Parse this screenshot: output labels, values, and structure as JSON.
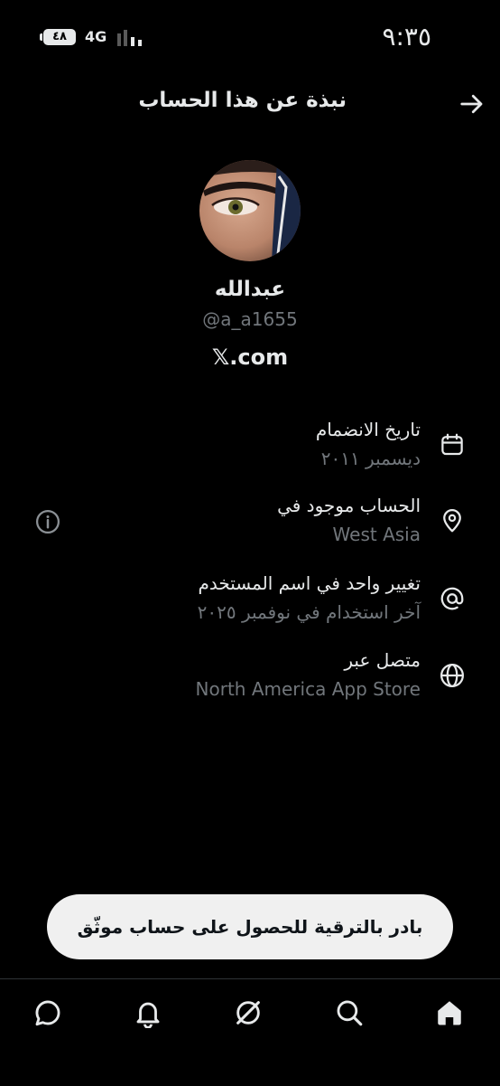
{
  "status_bar": {
    "time": "٩:٣٥",
    "battery": "٤٨",
    "network": "4G"
  },
  "header": {
    "title": "نبذة عن هذا الحساب",
    "back_icon": "arrow-right-icon"
  },
  "profile": {
    "name": "عبدالله",
    "handle": "@a_a1655",
    "site": "𝕏.com"
  },
  "details": [
    {
      "icon": "calendar-icon",
      "title": "تاريخ الانضمام",
      "value": "ديسمبر ٢٠١١"
    },
    {
      "icon": "location-icon",
      "title": "الحساب موجود في",
      "value": "West Asia"
    },
    {
      "icon": "at-icon",
      "title": "تغيير واحد في اسم المستخدم",
      "value": "آخر استخدام في نوفمبر ٢٠٢٥"
    },
    {
      "icon": "globe-icon",
      "title": "متصل عبر",
      "value": "North America App Store"
    }
  ],
  "upgrade_button": "بادر بالترقية للحصول على حساب موثّق",
  "bottom_nav": [
    "home-icon",
    "search-icon",
    "grok-icon",
    "notifications-icon",
    "messages-icon"
  ],
  "colors": {
    "background": "#000000",
    "text": "#e7e9ea",
    "muted": "#71767b",
    "button_bg": "#f0f0f0"
  }
}
